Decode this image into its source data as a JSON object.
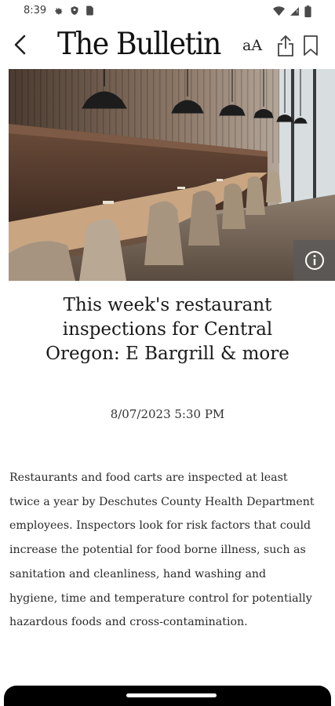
{
  "status_bar": {
    "time": "8:39",
    "left_icons": [
      "gear-icon",
      "shield-icon",
      "sim-card-icon"
    ],
    "right_icons": [
      "wifi-icon",
      "signal-icon",
      "battery-icon"
    ]
  },
  "header": {
    "brand": "The Bulletin",
    "text_size_label": "aA",
    "icons": [
      "back-arrow-icon",
      "share-icon",
      "bookmark-icon"
    ]
  },
  "hero": {
    "description_icon": "info-icon"
  },
  "article": {
    "headline": "This week's restaurant inspections for Central Oregon: E Bargrill & more",
    "date": "8/07/2023 5:30 PM",
    "body": "Restaurants and food carts are inspected at least twice a year by Deschutes County Health Department employees. Inspectors look for risk factors that could increase the potential for food borne illness, such as sanitation and cleanliness, hand washing and hygiene, time and temperature control for potentially hazardous foods and cross-contamination."
  },
  "colors": {
    "nav_bar": "#000000",
    "text": "#1a1a1a",
    "background": "#ffffff"
  }
}
